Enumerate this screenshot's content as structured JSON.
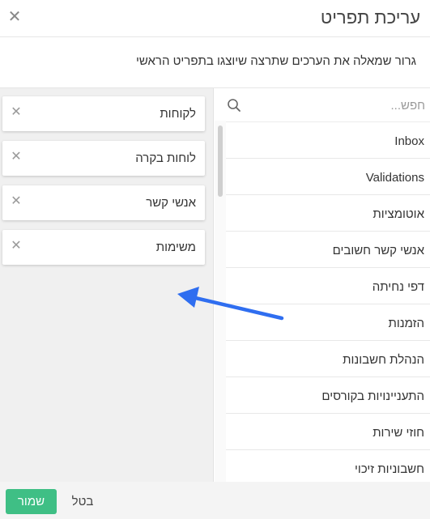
{
  "dialog": {
    "title": "עריכת תפריט",
    "instructions": "גרור שמאלה את הערכים שתרצה שיוצגו בתפריט הראשי",
    "close_glyph": "✕"
  },
  "selected_menu": {
    "remove_glyph": "✕",
    "items": [
      {
        "label": "לקוחות"
      },
      {
        "label": "לוחות בקרה"
      },
      {
        "label": "אנשי קשר"
      },
      {
        "label": "משימות"
      }
    ]
  },
  "search": {
    "placeholder": "חפש...",
    "value": ""
  },
  "available_menu": {
    "items": [
      {
        "label": "Inbox"
      },
      {
        "label": "Validations"
      },
      {
        "label": "אוטומציות"
      },
      {
        "label": "אנשי קשר חשובים"
      },
      {
        "label": "דפי נחיתה"
      },
      {
        "label": "הזמנות"
      },
      {
        "label": "הנהלת חשבונות"
      },
      {
        "label": "התעניינויות בקורסים"
      },
      {
        "label": "חוזי שירות"
      },
      {
        "label": "חשבוניות זיכוי"
      }
    ]
  },
  "footer": {
    "save_label": "שמור",
    "cancel_label": "בטל"
  },
  "colors": {
    "save_button": "#3fbf85",
    "arrow": "#2f6ef0",
    "selected_panel_bg": "#f0f0f0"
  },
  "icons": {
    "close": "close-icon",
    "search": "search-icon",
    "remove": "remove-icon",
    "arrow": "arrow-left-icon"
  }
}
